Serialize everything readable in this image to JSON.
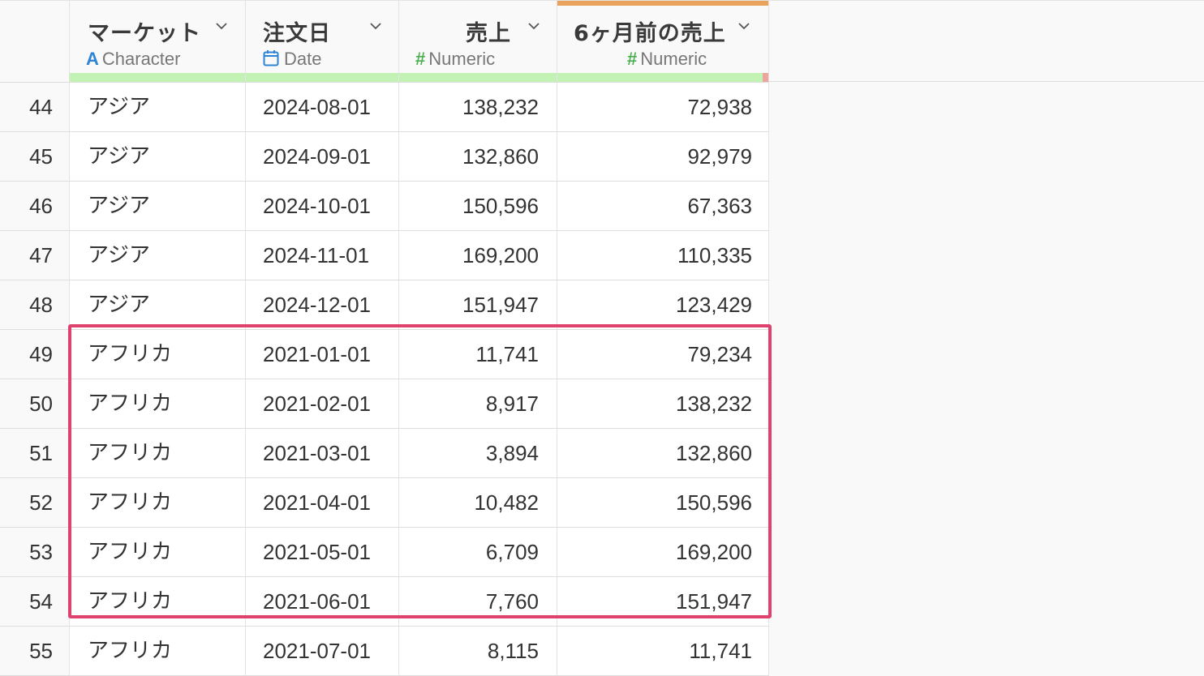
{
  "columns": [
    {
      "name": "マーケット",
      "type_label": "Character",
      "type_icon": "A"
    },
    {
      "name": "注文日",
      "type_label": "Date",
      "type_icon": "calendar"
    },
    {
      "name": "売上",
      "type_label": "Numeric",
      "type_icon": "#"
    },
    {
      "name": "6ヶ月前の売上",
      "type_label": "Numeric",
      "type_icon": "#"
    }
  ],
  "rows": [
    {
      "idx": "44",
      "market": "アジア",
      "date": "2024-08-01",
      "sales": "138,232",
      "prev": "72,938"
    },
    {
      "idx": "45",
      "market": "アジア",
      "date": "2024-09-01",
      "sales": "132,860",
      "prev": "92,979"
    },
    {
      "idx": "46",
      "market": "アジア",
      "date": "2024-10-01",
      "sales": "150,596",
      "prev": "67,363"
    },
    {
      "idx": "47",
      "market": "アジア",
      "date": "2024-11-01",
      "sales": "169,200",
      "prev": "110,335"
    },
    {
      "idx": "48",
      "market": "アジア",
      "date": "2024-12-01",
      "sales": "151,947",
      "prev": "123,429"
    },
    {
      "idx": "49",
      "market": "アフリカ",
      "date": "2021-01-01",
      "sales": "11,741",
      "prev": "79,234"
    },
    {
      "idx": "50",
      "market": "アフリカ",
      "date": "2021-02-01",
      "sales": "8,917",
      "prev": "138,232"
    },
    {
      "idx": "51",
      "market": "アフリカ",
      "date": "2021-03-01",
      "sales": "3,894",
      "prev": "132,860"
    },
    {
      "idx": "52",
      "market": "アフリカ",
      "date": "2021-04-01",
      "sales": "10,482",
      "prev": "150,596"
    },
    {
      "idx": "53",
      "market": "アフリカ",
      "date": "2021-05-01",
      "sales": "6,709",
      "prev": "169,200"
    },
    {
      "idx": "54",
      "market": "アフリカ",
      "date": "2021-06-01",
      "sales": "7,760",
      "prev": "151,947"
    },
    {
      "idx": "55",
      "market": "アフリカ",
      "date": "2021-07-01",
      "sales": "8,115",
      "prev": "11,741"
    }
  ],
  "colors": {
    "highlight": "#e0426e",
    "quality_bar": "#c3f3b4",
    "active_column_top": "#e8a25a",
    "character_icon": "#2b84d6",
    "numeric_icon": "#4caf50"
  }
}
